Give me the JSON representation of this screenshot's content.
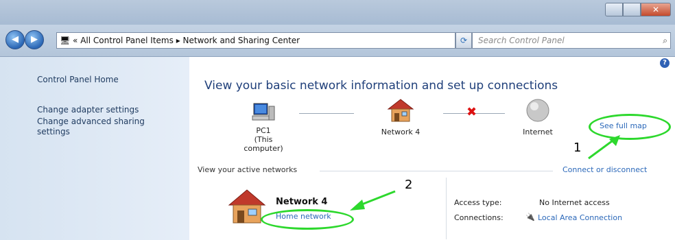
{
  "navbar": {
    "back_icon": "back-arrow-icon",
    "forward_icon": "forward-arrow-icon",
    "address": [
      "All Control Panel Items",
      "Network and Sharing Center"
    ],
    "search_placeholder": "Search Control Panel"
  },
  "sidebar": {
    "items": [
      {
        "label": "Control Panel Home"
      },
      {
        "label": "Change adapter settings"
      },
      {
        "label": "Change advanced sharing settings"
      }
    ]
  },
  "main": {
    "heading": "View your basic network information and set up connections",
    "see_full_map": "See full map",
    "map": {
      "pc": "PC1",
      "pc_sub": "(This computer)",
      "network": "Network 4",
      "internet": "Internet"
    },
    "active_networks_label": "View your active networks",
    "connect_link": "Connect or disconnect",
    "network": {
      "name": "Network 4",
      "type": "Home network"
    },
    "details": {
      "access_label": "Access type:",
      "access_value": "No Internet access",
      "connections_label": "Connections:",
      "connections_value": "Local Area Connection"
    }
  },
  "annotations": {
    "callout_1": "1",
    "callout_2": "2",
    "highlight_color": "#2dd82d"
  }
}
